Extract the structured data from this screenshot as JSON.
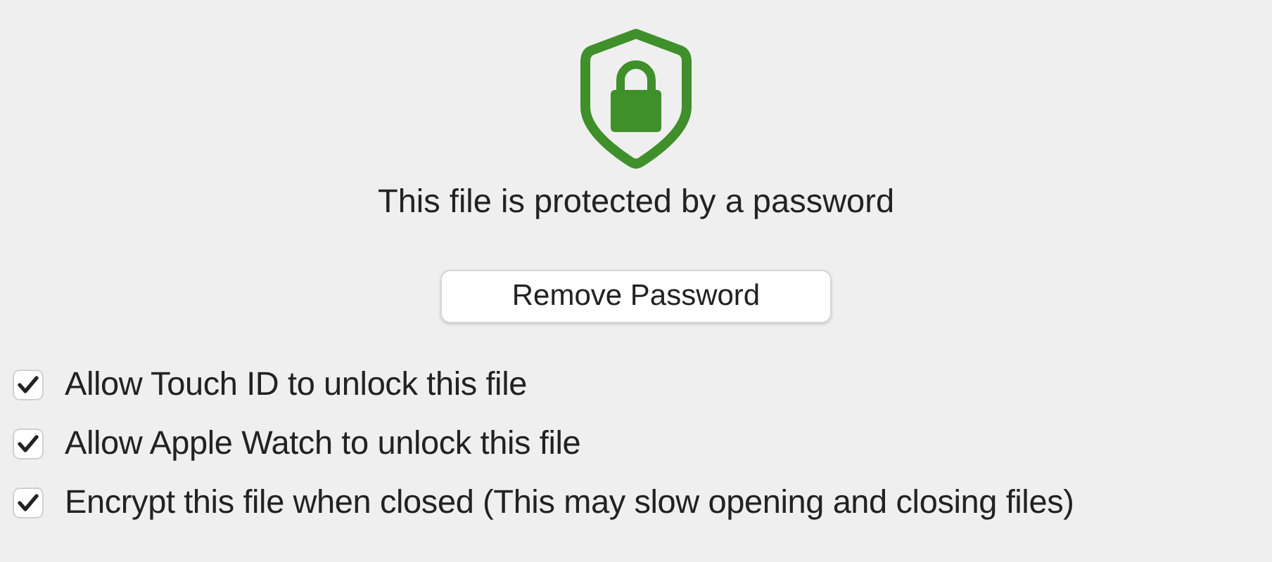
{
  "message": "This file is protected by a password",
  "button": "Remove Password",
  "options": [
    {
      "label": "Allow Touch ID to unlock this file",
      "checked": true
    },
    {
      "label": "Allow Apple Watch to unlock this file",
      "checked": true
    },
    {
      "label": "Encrypt this file when closed (This may slow opening and closing files)",
      "checked": true
    }
  ]
}
